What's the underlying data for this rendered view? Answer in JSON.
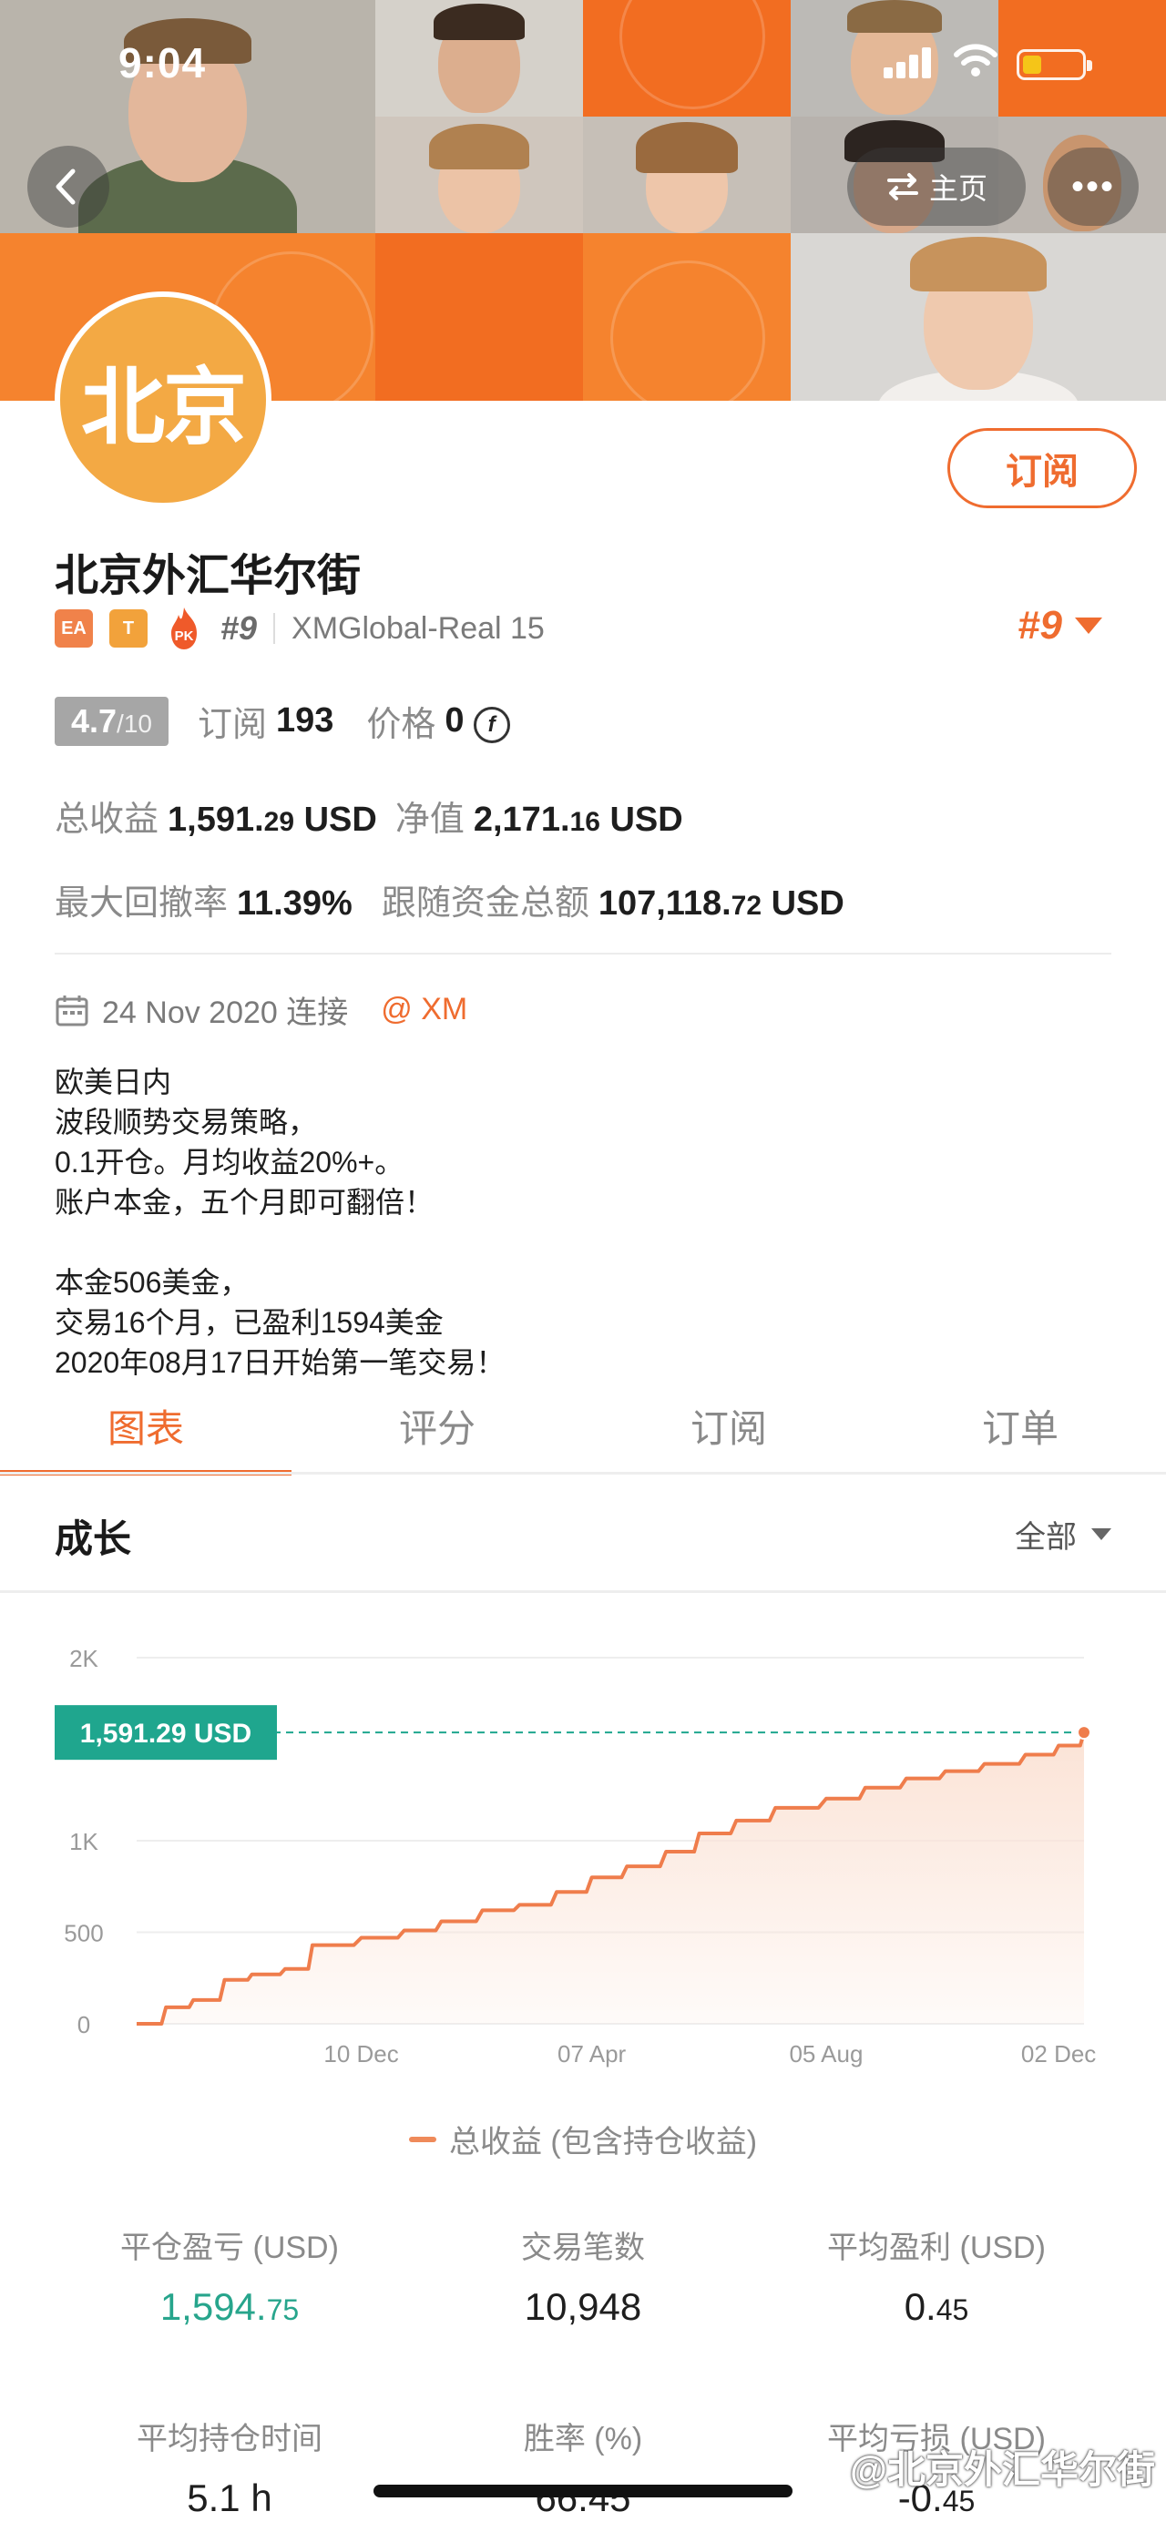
{
  "status_bar": {
    "time": "9:04"
  },
  "header": {
    "home_label": "主页",
    "more_label": "•••"
  },
  "profile": {
    "avatar_text": "北京",
    "subscribe_label": "订阅",
    "title": "北京外汇华尔街",
    "badges": {
      "ea": "EA",
      "t": "T",
      "pk": "PK",
      "rank": "#9"
    },
    "account": "XMGlobal-Real 15",
    "rank_big": "#9"
  },
  "stats": {
    "rating": "4.7",
    "rating_of": "/10",
    "subscribe_label": "订阅",
    "subscribe_count": "193",
    "price_label": "价格",
    "price_value": "0",
    "total_profit_label": "总收益",
    "total_profit_int": "1,591.",
    "total_profit_dec": "29",
    "total_profit_unit": " USD",
    "net_label": "净值",
    "net_int": "2,171.",
    "net_dec": "16",
    "net_unit": " USD",
    "drawdown_label": "最大回撤率",
    "drawdown_value": "11.39%",
    "follow_label": "跟随资金总额",
    "follow_int": "107,118.",
    "follow_dec": "72",
    "follow_unit": " USD"
  },
  "connect": {
    "date": "24 Nov 2020 连接",
    "broker": "@ XM"
  },
  "description": [
    "欧美日内",
    "波段顺势交易策略，",
    "0.1开仓。月均收益20%+。",
    "账户本金，五个月即可翻倍！",
    "",
    "本金506美金，",
    "交易16个月，已盈利1594美金",
    "2020年08月17日开始第一笔交易！"
  ],
  "tabs": [
    {
      "label": "图表",
      "active": true
    },
    {
      "label": "评分",
      "active": false
    },
    {
      "label": "订阅",
      "active": false
    },
    {
      "label": "订单",
      "active": false
    }
  ],
  "growth": {
    "title": "成长",
    "range": "全部"
  },
  "chart_data": {
    "type": "area",
    "x": [
      "2020-08-17",
      "2020-09-01",
      "2020-09-15",
      "2020-10-01",
      "2020-10-15",
      "2020-11-01",
      "2020-11-15",
      "2020-12-10",
      "2021-01-01",
      "2021-01-20",
      "2021-02-10",
      "2021-03-01",
      "2021-03-20",
      "2021-04-07",
      "2021-04-25",
      "2021-05-15",
      "2021-06-01",
      "2021-06-20",
      "2021-07-10",
      "2021-08-05",
      "2021-08-25",
      "2021-09-15",
      "2021-10-05",
      "2021-10-25",
      "2021-11-15",
      "2021-12-02",
      "2021-12-15"
    ],
    "values": [
      0,
      90,
      130,
      240,
      270,
      300,
      430,
      470,
      510,
      560,
      620,
      650,
      720,
      800,
      860,
      940,
      1040,
      1110,
      1180,
      1230,
      1290,
      1340,
      1380,
      1420,
      1470,
      1520,
      1591.29
    ],
    "series_label": "总收益 (包含持仓收益)",
    "current_label": "1,591.29 USD",
    "current_value": 1591.29,
    "y_ticks": [
      "0",
      "500",
      "1K",
      "2K"
    ],
    "y_tick_values": [
      0,
      500,
      1000,
      2000
    ],
    "x_ticks": [
      "10 Dec",
      "07 Apr",
      "05 Aug",
      "02 Dec"
    ],
    "x_tick_dates": [
      "2020-12-10",
      "2021-04-07",
      "2021-08-05",
      "2021-12-02"
    ],
    "ylim": [
      0,
      2000
    ],
    "xlim": [
      "2020-08-17",
      "2021-12-15"
    ],
    "grid": true,
    "colors": {
      "line": "#ef7d4c",
      "fill": "#fbe3d6",
      "marker": "#1fa68e"
    }
  },
  "bottom_stats": [
    {
      "label": "平仓盈亏 (USD)",
      "int": "1,594.",
      "dec": "75",
      "green": true
    },
    {
      "label": "交易笔数",
      "int": "10,948",
      "dec": "",
      "green": false
    },
    {
      "label": "平均盈利 (USD)",
      "int": "0.",
      "dec": "45",
      "green": false
    },
    {
      "label": "平均持仓时间",
      "int": "5.1 h",
      "dec": "",
      "green": false
    },
    {
      "label": "胜率 (%)",
      "int": "66.45",
      "dec": "",
      "green": false
    },
    {
      "label": "平均亏损 (USD)",
      "int": "-0.",
      "dec": "45",
      "green": false
    }
  ],
  "watermark": "@北京外汇华尔街",
  "colors": {
    "accent": "#ef6c2f",
    "green": "#27a58c"
  }
}
